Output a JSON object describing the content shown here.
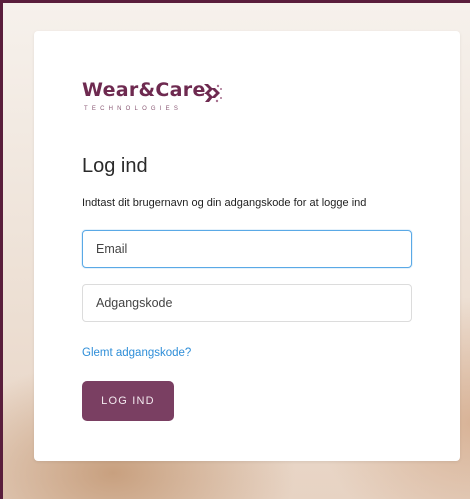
{
  "brand": {
    "name": "Wear&Care",
    "tagline": "TECHNOLOGIES",
    "icon": "logo-chevrons-icon",
    "color": "#6e2a50"
  },
  "login": {
    "title": "Log ind",
    "subtitle": "Indtast dit brugernavn og din adgangskode for at logge ind",
    "email_placeholder": "Email",
    "email_value": "",
    "password_placeholder": "Adgangskode",
    "password_value": "",
    "forgot_label": "Glemt adgangskode?",
    "submit_label": "LOG IND"
  },
  "colors": {
    "accent": "#7a3f62",
    "link": "#2e8ed8",
    "focus_border": "#5aa9e6",
    "frame": "#5a1e3c"
  }
}
